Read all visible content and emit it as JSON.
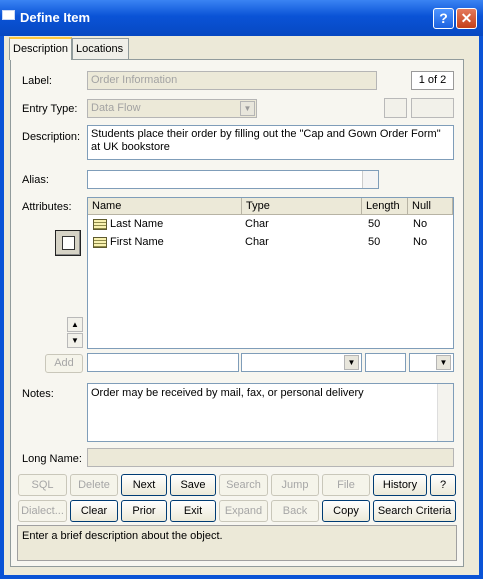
{
  "window": {
    "title": "Define Item",
    "help_glyph": "?",
    "close_glyph": "✕"
  },
  "tabs": [
    {
      "label": "Description"
    },
    {
      "label": "Locations"
    }
  ],
  "form": {
    "label_caption": "Label:",
    "label_value": "Order Information",
    "page_indicator": "1 of 2",
    "entry_type_caption": "Entry Type:",
    "entry_type_value": "Data Flow",
    "description_caption": "Description:",
    "description_value": "Students place their order by filling out the \"Cap and Gown Order Form\" at UK bookstore",
    "alias_caption": "Alias:",
    "alias_value": "",
    "attributes_caption": "Attributes:",
    "notes_caption": "Notes:",
    "notes_value": "Order may be received by mail, fax, or personal delivery",
    "long_name_caption": "Long Name:",
    "long_name_value": "",
    "add_label": "Add"
  },
  "attributes_table": {
    "headers": [
      "Name",
      "Type",
      "Length",
      "Null"
    ],
    "rows": [
      {
        "name": "Last Name",
        "type": "Char",
        "length": "50",
        "null": "No"
      },
      {
        "name": "First Name",
        "type": "Char",
        "length": "50",
        "null": "No"
      }
    ]
  },
  "buttons": {
    "row1": [
      "SQL",
      "Delete",
      "Next",
      "Save",
      "Search",
      "Jump",
      "File",
      "History",
      "?"
    ],
    "row2": [
      "Dialect...",
      "Clear",
      "Prior",
      "Exit",
      "Expand",
      "Back",
      "Copy",
      "Search Criteria"
    ]
  },
  "status_text": "Enter a brief description about the object."
}
